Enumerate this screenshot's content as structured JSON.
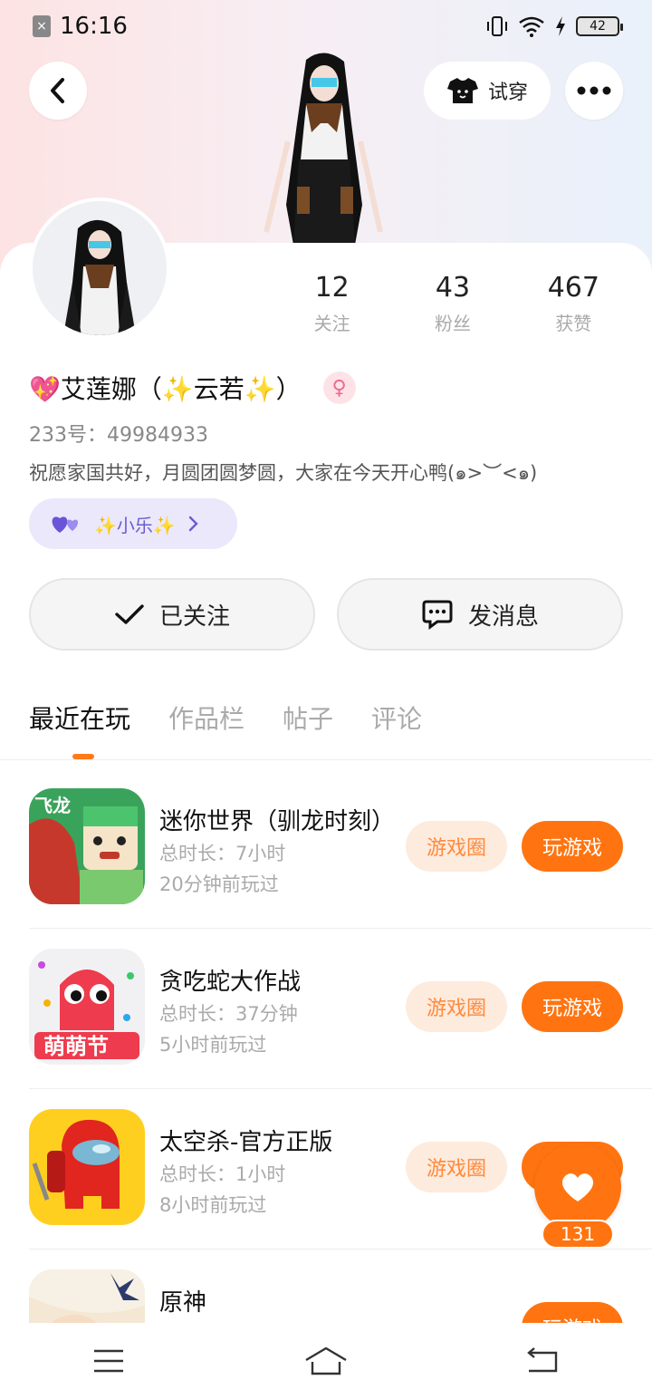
{
  "status_bar": {
    "time": "16:16",
    "battery": "42"
  },
  "header": {
    "tryon_label": "试穿"
  },
  "profile": {
    "stats": [
      {
        "value": "12",
        "label": "关注"
      },
      {
        "value": "43",
        "label": "粉丝"
      },
      {
        "value": "467",
        "label": "获赞"
      }
    ],
    "name": "💖艾莲娜（✨云若✨）",
    "gender_symbol": "♀",
    "uid_label": "233号：49984933",
    "bio": "祝愿家国共好，月圆团圆梦圆，大家在今天开心鸭(๑>︶<๑)",
    "club_name": "✨小乐✨"
  },
  "actions": {
    "follow_label": "已关注",
    "message_label": "发消息"
  },
  "tabs": [
    {
      "label": "最近在玩"
    },
    {
      "label": "作品栏"
    },
    {
      "label": "帖子"
    },
    {
      "label": "评论"
    }
  ],
  "games": [
    {
      "title": "迷你世界（驯龙时刻）",
      "duration": "总时长：7小时",
      "last_played": "20分钟前玩过",
      "circle_label": "游戏圈",
      "play_label": "玩游戏"
    },
    {
      "title": "贪吃蛇大作战",
      "duration": "总时长：37分钟",
      "last_played": "5小时前玩过",
      "circle_label": "游戏圈",
      "play_label": "玩游戏"
    },
    {
      "title": "太空杀-官方正版",
      "duration": "总时长：1小时",
      "last_played": "8小时前玩过",
      "circle_label": "游戏圈",
      "play_label": "玩游戏"
    },
    {
      "title": "原神",
      "duration": "",
      "last_played": "",
      "circle_label": "",
      "play_label": "玩游戏"
    }
  ],
  "like_fab": {
    "count": "131"
  },
  "colors": {
    "accent": "#ff7410",
    "chip_bg": "#fdebdd",
    "club_bg": "#ebe8fb"
  }
}
